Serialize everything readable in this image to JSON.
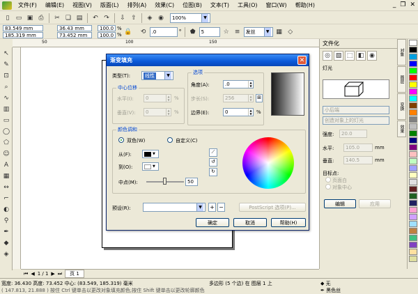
{
  "menu": [
    "文件(F)",
    "编辑(E)",
    "视图(V)",
    "版面(L)",
    "排列(A)",
    "效果(C)",
    "位图(B)",
    "文本(T)",
    "工具(O)",
    "窗口(W)",
    "帮助(H)"
  ],
  "toolbar": {
    "zoom": "100%"
  },
  "propbar": {
    "x": "83.549 mm",
    "y": "185.319 mm",
    "w": "36.43 mm",
    "h": "73.452 mm",
    "sx": "100.0",
    "sy": "100.0",
    "pct": "%",
    "angle": ".0",
    "deg": "°",
    "outline_width": "5",
    "outline": "发丝"
  },
  "ruler": [
    "50",
    "100",
    "150"
  ],
  "dialog": {
    "title": "渐变填充",
    "type_label": "类型(T):",
    "type_value": "线性",
    "center_group": "中心位移",
    "h_label": "水平(I):",
    "h_value": "0",
    "v_label": "垂直(V):",
    "v_value": "0",
    "pct": "%",
    "options_group": "选项",
    "angle_label": "角度(A):",
    "angle_value": ".0",
    "steps_label": "步长(S):",
    "steps_value": "256",
    "padding_label": "边界(E):",
    "padding_value": "0",
    "blend_group": "颜色调和",
    "two_color": "双色(W)",
    "custom": "自定义(C)",
    "from_label": "从(F):",
    "to_label": "到(O):",
    "mid_label": "中点(M):",
    "mid_value": "50",
    "preset_label": "预设(R):",
    "postscript": "PostScript 选项(P)...",
    "ok": "确定",
    "cancel": "取消",
    "help": "帮助(H)"
  },
  "docker": {
    "title": "文件化",
    "light_label": "灯光",
    "light_dropdown": "小后端",
    "light_dropdown2": "创造对象上的灯光",
    "intensity_label": "强度:",
    "intensity_value": "20.0",
    "horiz_label": "水平:",
    "horiz_value": "105.0",
    "unit": "mm",
    "vert_label": "垂直:",
    "vert_value": "140.5",
    "target_label": "目标点:",
    "target_page": "页面白",
    "target_center": "对象中心",
    "edit": "编辑",
    "apply": "应用"
  },
  "vtabs": [
    "对象",
    "图层",
    "变换",
    "效果",
    "文本"
  ],
  "palette": [
    "#ffffff",
    "#000000",
    "#00a0e0",
    "#0000ff",
    "#00ff00",
    "#ff0000",
    "#ffff00",
    "#ff00ff",
    "#00ffff",
    "#804000",
    "#ff8000",
    "#808080",
    "#c0c0c0",
    "#008000",
    "#000080",
    "#800080",
    "#ffc0c0",
    "#c0ffc0",
    "#a0a0ff",
    "#ffffc0",
    "#e0e0e0",
    "#602020",
    "#206020",
    "#202060",
    "#ffa0d0",
    "#d0a0ff",
    "#a0e0ff",
    "#c08040",
    "#40c080",
    "#8040c0",
    "#ffe0a0",
    "#e0e0a0"
  ],
  "pagenav": {
    "pages": "1 / 1",
    "tab": "页 1"
  },
  "status": {
    "line1": "宽度: 36.430  高度: 73.452  中心: (83.549, 185.319)  毫米",
    "line1b": "多边形 (5 个边) 在 图层 1 上",
    "line2": "( 147.813, 21.888 )   按住 Ctrl 键单击以更改对象填充颜色;按住 Shift 键单击以更改轮廓颜色",
    "fill": "无",
    "outline": "黑色丝"
  }
}
